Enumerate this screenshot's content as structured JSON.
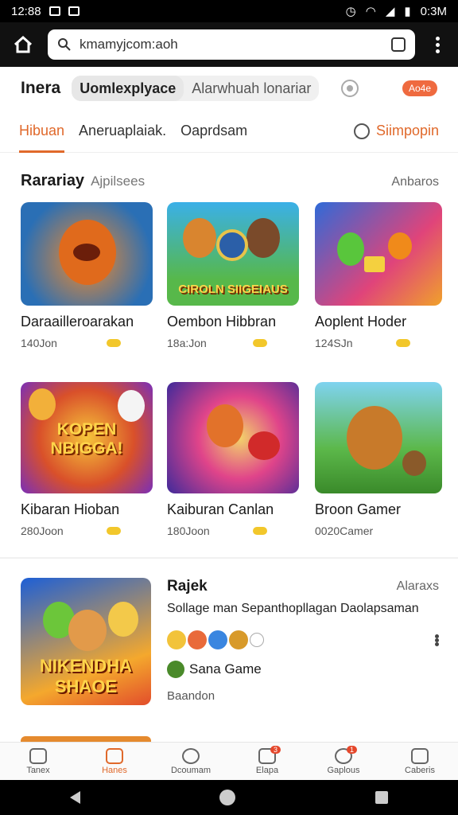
{
  "status": {
    "time": "12:88",
    "right_time": "0:3M"
  },
  "browser": {
    "url": "kmamyjcom:aoh"
  },
  "topbar": {
    "brand": "Inera",
    "segment_active": "Uomlexplyace",
    "segment_inactive": "Alarwhuah lonariar",
    "badge": "Ao4e"
  },
  "tabs": {
    "items": [
      "Hibuan",
      "Aneruaplaiak.",
      "Oaprdsam"
    ],
    "signin": "Siimpopin"
  },
  "section": {
    "title": "Rarariay",
    "subtitle": "Ajpilsees",
    "more": "Anbaros"
  },
  "games": [
    {
      "name": "Daraailleroarakan",
      "meta": "140Jon",
      "art": ""
    },
    {
      "name": "Oembon Hibbran",
      "meta": "18a:Jon",
      "art": "CIROLN SIIGEIAUS"
    },
    {
      "name": "Aoplent Hoder",
      "meta": "124SJn",
      "art": ""
    },
    {
      "name": "Kibaran Hioban",
      "meta": "280Joon",
      "art": "KOPEN NBIGGA!"
    },
    {
      "name": "Kaiburan Canlan",
      "meta": "180Joon",
      "art": ""
    },
    {
      "name": "Broon Gamer",
      "meta": "0020Camer",
      "art": ""
    }
  ],
  "feature": {
    "title": "Rajek",
    "side": "Alaraxs",
    "description": "Sollage man Sepanthopllagan Daolapsaman",
    "studio": "Sana Game",
    "owner": "Baandon",
    "art": "NIKENDHA SHAOE"
  },
  "bottom_nav": [
    {
      "label": "Tanex",
      "badge": ""
    },
    {
      "label": "Hanes",
      "badge": ""
    },
    {
      "label": "Dcoumam",
      "badge": ""
    },
    {
      "label": "Elapa",
      "badge": "3"
    },
    {
      "label": "Gaplous",
      "badge": "1"
    },
    {
      "label": "Caberis",
      "badge": ""
    }
  ],
  "colors": {
    "accent": "#e0692b",
    "badge": "#ef6a3f"
  }
}
